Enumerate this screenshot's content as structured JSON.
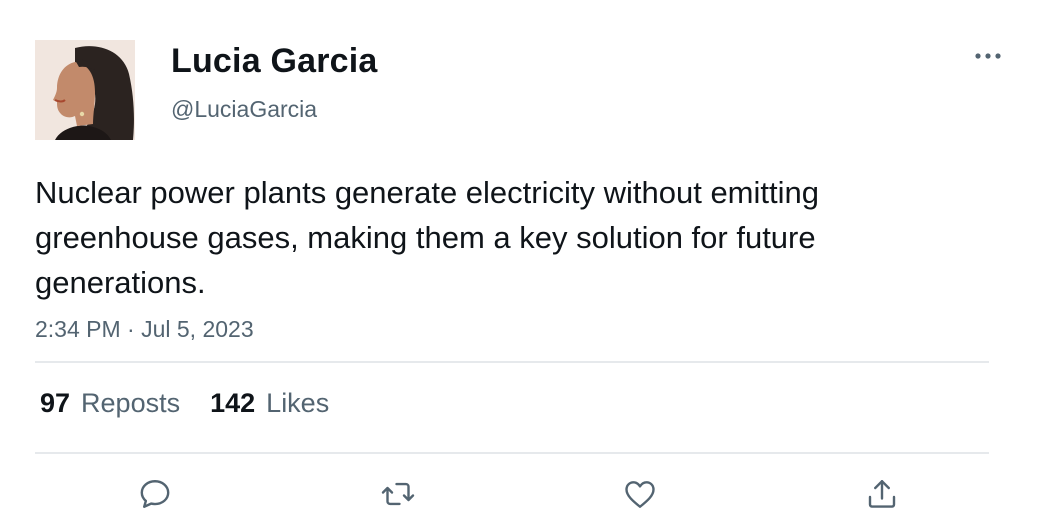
{
  "author": {
    "name": "Lucia Garcia",
    "handle": "@LuciaGarcia"
  },
  "tweet": {
    "text": "Nuclear power plants generate electricity without emitting greenhouse gases, making them a key solution for future generations.",
    "timestamp": "2:34 PM · Jul 5, 2023"
  },
  "stats": {
    "reposts_count": "97",
    "reposts_label": "Reposts",
    "likes_count": "142",
    "likes_label": "Likes"
  },
  "icons": {
    "more": "more-horizontal-icon",
    "reply": "reply-icon",
    "repost": "repost-icon",
    "like": "heart-icon",
    "share": "share-icon"
  },
  "colors": {
    "text": "#0f1419",
    "secondary": "#536471",
    "divider": "#e6e9ec"
  }
}
